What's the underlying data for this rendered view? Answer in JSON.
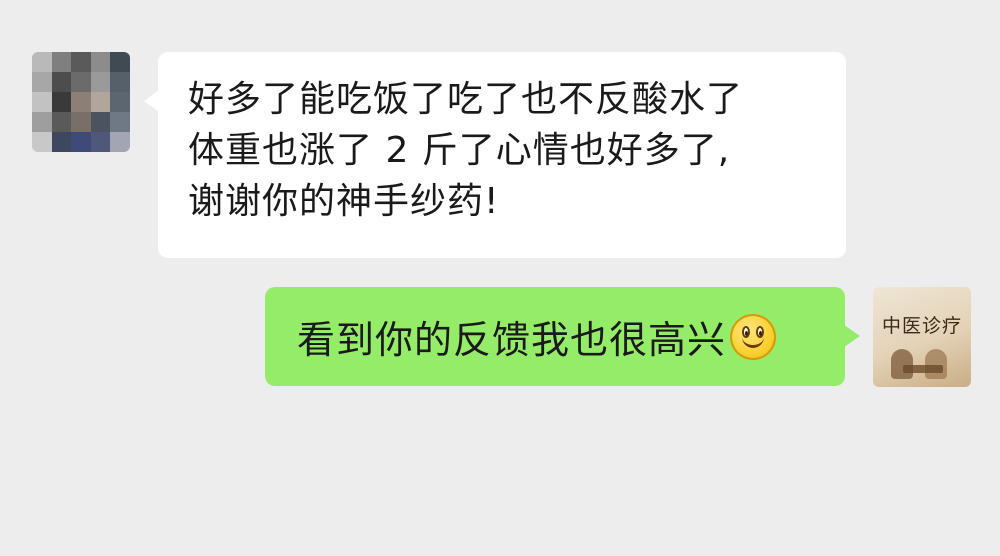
{
  "messages": {
    "incoming": {
      "lines": [
        "好多了能吃饭了吃了也不反酸水了",
        "体重也涨了 2 斤了心情也好多了,",
        "谢谢你的神手纱药!"
      ]
    },
    "outgoing": {
      "text": "看到你的反馈我也很高兴",
      "emoji": "smiley-icon"
    }
  },
  "avatars": {
    "right": {
      "logo_text": "中医诊疗"
    }
  },
  "colors": {
    "background": "#ededed",
    "incoming_bubble": "#ffffff",
    "outgoing_bubble": "#95ec69"
  }
}
